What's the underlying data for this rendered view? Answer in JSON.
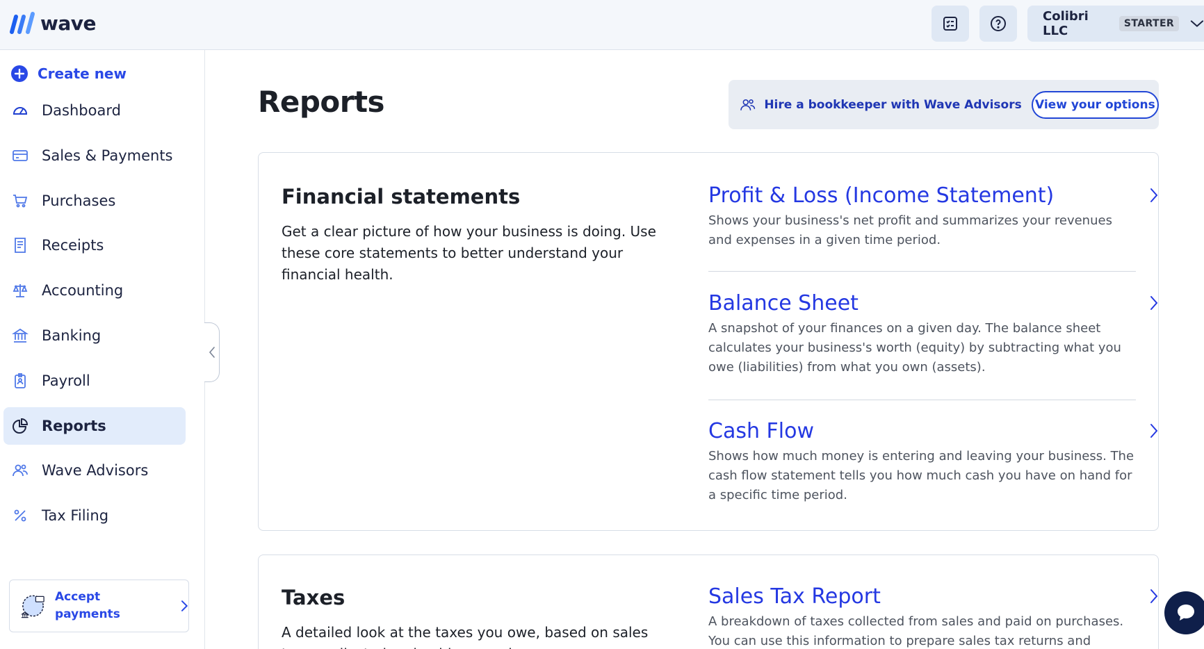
{
  "header": {
    "logo_text": "wave",
    "company_name": "Colibri LLC",
    "plan_badge": "STARTER",
    "icons": [
      "checklist-icon",
      "help-icon",
      "chevron-down-icon"
    ]
  },
  "sidebar": {
    "create_new_label": "Create new",
    "items": [
      {
        "label": "Dashboard",
        "icon": "dashboard-icon"
      },
      {
        "label": "Sales & Payments",
        "icon": "credit-card-icon"
      },
      {
        "label": "Purchases",
        "icon": "cart-icon"
      },
      {
        "label": "Receipts",
        "icon": "receipt-icon"
      },
      {
        "label": "Accounting",
        "icon": "scale-icon"
      },
      {
        "label": "Banking",
        "icon": "bank-icon"
      },
      {
        "label": "Payroll",
        "icon": "badge-icon"
      },
      {
        "label": "Reports",
        "icon": "reports-icon",
        "active": true
      },
      {
        "label": "Wave Advisors",
        "icon": "advisors-icon"
      },
      {
        "label": "Tax Filing",
        "icon": "percent-icon"
      }
    ],
    "accept_payments_label": "Accept payments"
  },
  "main": {
    "title": "Reports",
    "advisor_banner": {
      "text": "Hire a bookkeeper with Wave Advisors",
      "button_label": "View your options"
    },
    "sections": [
      {
        "title": "Financial statements",
        "description": "Get a clear picture of how your business is doing. Use these core statements to better understand your financial health.",
        "reports": [
          {
            "title": "Profit & Loss (Income Statement)",
            "description": "Shows your business's net profit and summarizes your revenues and expenses in a given time period."
          },
          {
            "title": "Balance Sheet",
            "description": "A snapshot of your finances on a given day. The balance sheet calculates your business's worth (equity) by subtracting what you owe (liabilities) from what you own (assets)."
          },
          {
            "title": "Cash Flow",
            "description": "Shows how much money is entering and leaving your business. The cash flow statement tells you how much cash you have on hand for a specific time period."
          }
        ]
      },
      {
        "title": "Taxes",
        "description": "A detailed look at the taxes you owe, based on sales taxes collected and paid on purchases.",
        "reports": [
          {
            "title": "Sales Tax Report",
            "description": "A breakdown of taxes collected from sales and paid on purchases. You can use this information to prepare sales tax returns and"
          }
        ]
      }
    ]
  },
  "colors": {
    "brand_blue": "#2948e6",
    "link_blue": "#2438e2",
    "nav_text": "#1c2340",
    "active_bg": "#e2ecfb",
    "chat_bg": "#0f1f4a"
  }
}
